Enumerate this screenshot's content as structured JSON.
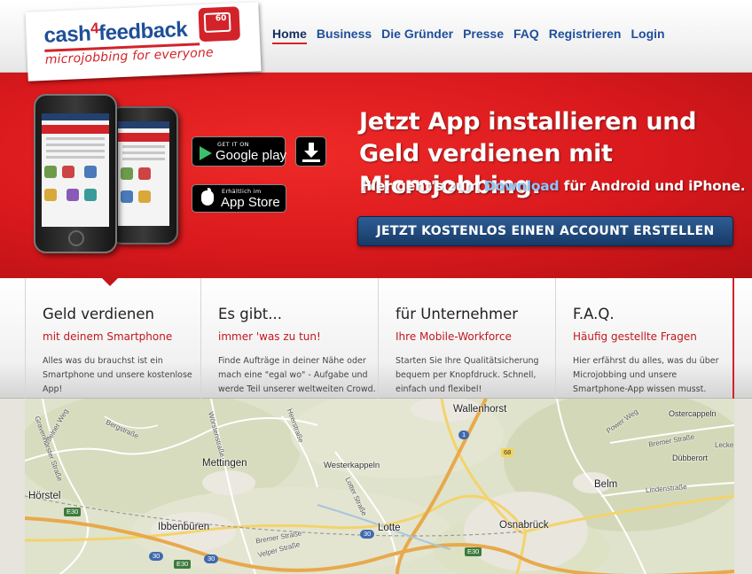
{
  "logo": {
    "word_part1": "cash",
    "word_four": "4",
    "word_part2": "feedback",
    "bubble_number": "60",
    "tagline": "microjobbing for everyone"
  },
  "nav": {
    "items": [
      "Home",
      "Business",
      "Die Gründer",
      "Presse",
      "FAQ",
      "Registrieren",
      "Login"
    ],
    "active": "Home"
  },
  "hero": {
    "headline": "Jetzt App installieren und Geld verdienen mit Microjobbing.",
    "sub_before": "Hier geht's zum ",
    "sub_link": "Download",
    "sub_after": " für Android und iPhone.",
    "cta": "JETZT KOSTENLOS EINEN ACCOUNT ERSTELLEN",
    "google_play": {
      "small": "GET IT ON",
      "big": "Google play"
    },
    "app_store": {
      "small": "Erhältlich im",
      "big": "App Store"
    }
  },
  "features": [
    {
      "title": "Geld verdienen",
      "subtitle": "mit deinem Smartphone",
      "description": "Alles was du brauchst ist ein Smartphone und unsere kostenlose App!"
    },
    {
      "title": "Es gibt...",
      "subtitle": "immer 'was zu tun!",
      "description": "Finde Aufträge in deiner Nähe oder mach eine \"egal wo\" - Aufgabe und werde Teil unserer weltweiten Crowd."
    },
    {
      "title": "für Unternehmer",
      "subtitle": "Ihre Mobile-Workforce",
      "description": "Starten Sie Ihre Qualitätsicherung bequem per Knopfdruck. Schnell, einfach und flexibel!"
    },
    {
      "title": "F.A.Q.",
      "subtitle": "Häufig gestellte Fragen",
      "description": "Hier erfährst du alles, was du über Microjobbing und unsere Smartphone-App wissen musst."
    }
  ],
  "map": {
    "places": [
      "Wallenhorst",
      "Ostercappeln",
      "Mettingen",
      "Westerkappeln",
      "Hörstel",
      "Belm",
      "Ibbenbüren",
      "Lotte",
      "Osnabrück",
      "Dübberort"
    ],
    "streets": [
      "Bergstraße",
      "Uffelner Weg",
      "Gravenhorster Straße",
      "Wörstenstraße",
      "Heerstraße",
      "Lotter Straße",
      "Bremer Straße",
      "Lindenstraße",
      "Power Weg",
      "Velper Straße",
      "Bremer Straße",
      "Lecke"
    ],
    "shields": [
      "1",
      "68",
      "E30",
      "30",
      "E30",
      "30",
      "E30",
      "30"
    ]
  },
  "colors": {
    "brand_red": "#d2232a",
    "brand_blue": "#1f4f9a",
    "cta_blue": "#1f4677",
    "link_blue": "#8cc6ff"
  }
}
